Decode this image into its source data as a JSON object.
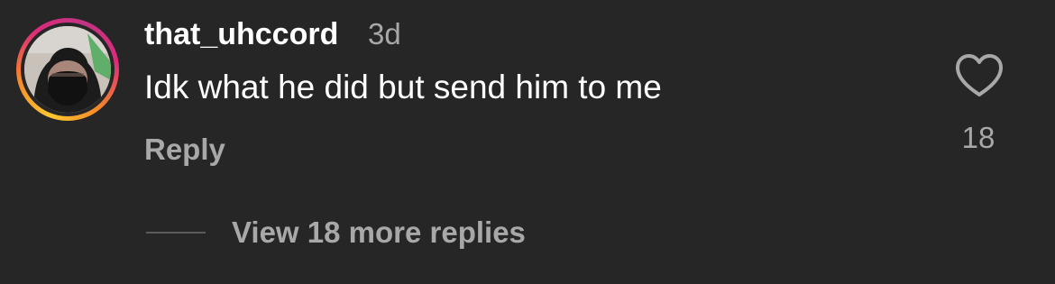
{
  "comment": {
    "username": "that_uhccord",
    "timestamp": "3d",
    "text": "Idk what he did but send him to me",
    "reply_label": "Reply",
    "like_count": "18",
    "view_replies_label": "View 18 more replies"
  },
  "icons": {
    "like": "heart-outline-icon",
    "avatar": "user-avatar"
  },
  "colors": {
    "background": "#262626",
    "primary_text": "#ffffff",
    "secondary_text": "#a8a8a8",
    "story_ring_start": "#fdc830",
    "story_ring_end": "#dd2a7b"
  }
}
